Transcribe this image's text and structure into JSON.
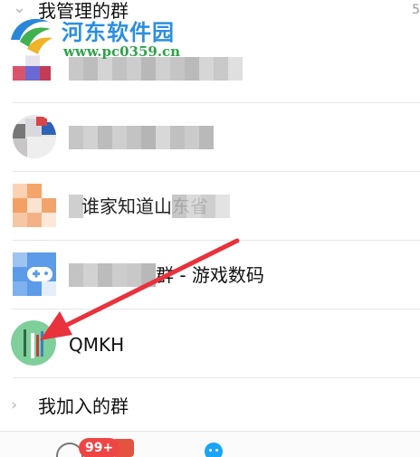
{
  "watermark": {
    "title": "河东软件园",
    "url": "www.pc0359.cn"
  },
  "managed_section": {
    "title": "我管理的群",
    "count_partial": "5",
    "groups": [
      {
        "name": "",
        "blurred": true
      },
      {
        "name": "",
        "blurred": true
      },
      {
        "name": "谁家知道山东省",
        "blurred": true
      },
      {
        "name": "群 - 游戏数码",
        "blurred": true
      },
      {
        "name": "QMKH",
        "blurred": false
      }
    ]
  },
  "joined_section": {
    "title": "我加入的群"
  },
  "bottom_nav": {
    "badge": "99+",
    "icons": [
      "message-icon",
      "contacts-icon"
    ]
  },
  "colors": {
    "divider": "#e6e6e6",
    "arrow": "#e8323c",
    "badge": "#f04545",
    "watermark_blue": "#2c8fe0",
    "watermark_green": "#2fa24a"
  }
}
